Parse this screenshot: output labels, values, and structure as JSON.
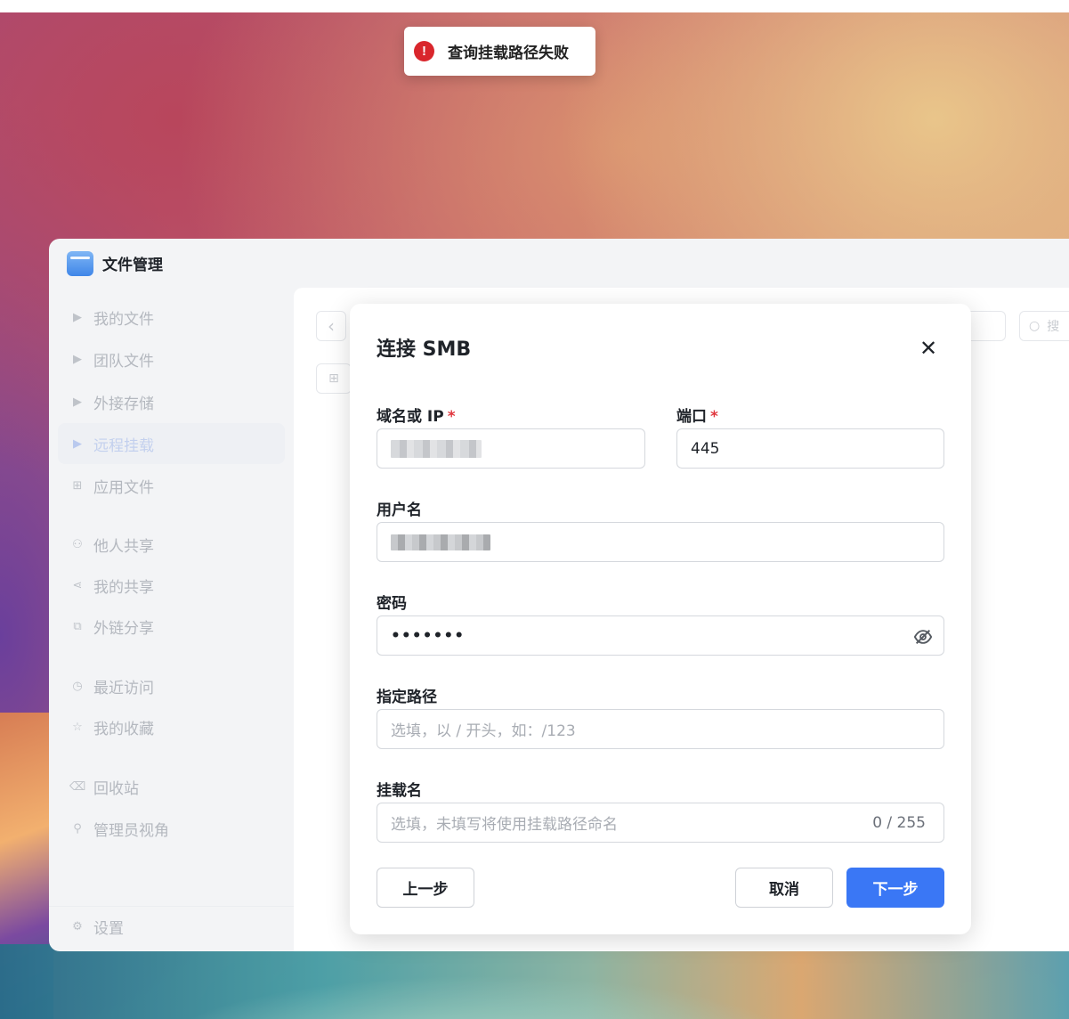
{
  "toast": {
    "icon": "error-icon",
    "glyph": "!",
    "message": "查询挂载路径失败"
  },
  "app": {
    "title": "文件管理",
    "icon": "folder-icon"
  },
  "sidebar": {
    "items": [
      {
        "label": "我的文件",
        "icon": "caret-right-icon",
        "glyph": "▶"
      },
      {
        "label": "团队文件",
        "icon": "caret-right-icon",
        "glyph": "▶"
      },
      {
        "label": "外接存储",
        "icon": "caret-right-icon",
        "glyph": "▶"
      },
      {
        "label": "远程挂载",
        "icon": "caret-right-icon",
        "glyph": "▶",
        "active": true
      },
      {
        "label": "应用文件",
        "icon": "apps-grid-icon",
        "glyph": "⊞"
      },
      {
        "label": "他人共享",
        "icon": "users-icon",
        "glyph": "⚇"
      },
      {
        "label": "我的共享",
        "icon": "share-icon",
        "glyph": "⋖"
      },
      {
        "label": "外链分享",
        "icon": "external-link-icon",
        "glyph": "⧉"
      },
      {
        "label": "最近访问",
        "icon": "clock-icon",
        "glyph": "◷"
      },
      {
        "label": "我的收藏",
        "icon": "star-icon",
        "glyph": "☆"
      },
      {
        "label": "回收站",
        "icon": "trash-icon",
        "glyph": "⌫"
      },
      {
        "label": "管理员视角",
        "icon": "admin-icon",
        "glyph": "⚲"
      }
    ],
    "settings": {
      "label": "设置",
      "icon": "gear-icon",
      "glyph": "⚙"
    }
  },
  "toolbar": {
    "back_glyph": "‹",
    "new_folder_glyph": "⊞",
    "search_glyph": "○",
    "search_placeholder": "搜"
  },
  "dialog": {
    "title": "连接 SMB",
    "close_glyph": "✕",
    "fields": {
      "host": {
        "label": "域名或 IP",
        "required": "*",
        "value": ""
      },
      "port": {
        "label": "端口",
        "required": "*",
        "value": "445"
      },
      "username": {
        "label": "用户名",
        "value": ""
      },
      "password": {
        "label": "密码",
        "value": "•••••••",
        "toggle_icon": "eye-off-icon"
      },
      "path": {
        "label": "指定路径",
        "placeholder": "选填，以 / 开头，如：/123"
      },
      "mount_name": {
        "label": "挂载名",
        "placeholder": "选填，未填写将使用挂载路径命名",
        "counter": "0 / 255"
      }
    },
    "buttons": {
      "prev": "上一步",
      "cancel": "取消",
      "next": "下一步"
    }
  },
  "colors": {
    "primary": "#3a77f5",
    "error": "#d9262c",
    "required": "#e0363d"
  }
}
